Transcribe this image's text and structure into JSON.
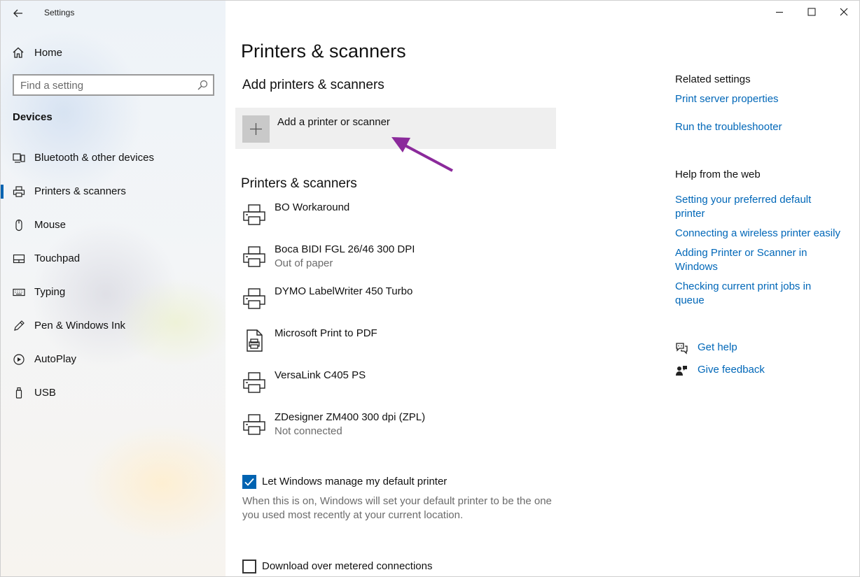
{
  "window": {
    "title": "Settings"
  },
  "sidebar": {
    "home_label": "Home",
    "search_placeholder": "Find a setting",
    "section_heading": "Devices",
    "items": [
      {
        "label": "Bluetooth & other devices",
        "icon": "bluetooth-devices-icon",
        "selected": false
      },
      {
        "label": "Printers & scanners",
        "icon": "printer-icon",
        "selected": true
      },
      {
        "label": "Mouse",
        "icon": "mouse-icon",
        "selected": false
      },
      {
        "label": "Touchpad",
        "icon": "touchpad-icon",
        "selected": false
      },
      {
        "label": "Typing",
        "icon": "keyboard-icon",
        "selected": false
      },
      {
        "label": "Pen & Windows Ink",
        "icon": "pen-icon",
        "selected": false
      },
      {
        "label": "AutoPlay",
        "icon": "autoplay-icon",
        "selected": false
      },
      {
        "label": "USB",
        "icon": "usb-icon",
        "selected": false
      }
    ]
  },
  "main": {
    "page_title": "Printers & scanners",
    "add_heading": "Add printers & scanners",
    "add_button_label": "Add a printer or scanner",
    "list_heading": "Printers & scanners",
    "printers": [
      {
        "name": "BO Workaround",
        "status": "",
        "icon": "printer-icon"
      },
      {
        "name": "Boca BIDI FGL 26/46 300 DPI",
        "status": "Out of paper",
        "icon": "printer-icon"
      },
      {
        "name": "DYMO LabelWriter 450 Turbo",
        "status": "",
        "icon": "printer-icon"
      },
      {
        "name": "Microsoft Print to PDF",
        "status": "",
        "icon": "pdf-printer-icon"
      },
      {
        "name": "VersaLink C405 PS",
        "status": "",
        "icon": "printer-icon"
      },
      {
        "name": "ZDesigner ZM400 300 dpi (ZPL)",
        "status": "Not connected",
        "icon": "printer-icon"
      }
    ],
    "manage_default": {
      "label": "Let Windows manage my default printer",
      "checked": true,
      "description": "When this is on, Windows will set your default printer to be the one you used most recently at your current location."
    },
    "metered": {
      "label": "Download over metered connections",
      "checked": false
    }
  },
  "related": {
    "heading": "Related settings",
    "links": [
      "Print server properties",
      "Run the troubleshooter"
    ]
  },
  "help_web": {
    "heading": "Help from the web",
    "links": [
      "Setting your preferred default printer",
      "Connecting a wireless printer easily",
      "Adding Printer or Scanner in Windows",
      "Checking current print jobs in queue"
    ]
  },
  "support": {
    "get_help": "Get help",
    "give_feedback": "Give feedback"
  },
  "colors": {
    "accent": "#0063b1",
    "link": "#0067b8",
    "annotation_arrow": "#8b2a9b"
  }
}
